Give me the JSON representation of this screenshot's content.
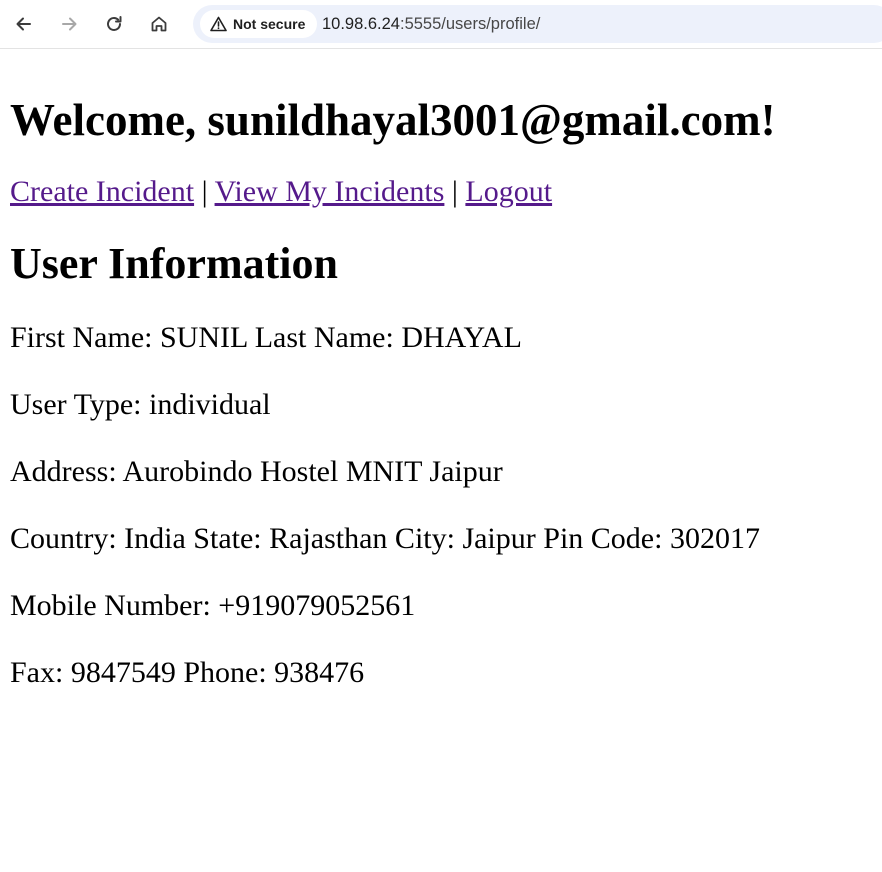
{
  "browser": {
    "security_label": "Not secure",
    "url_host": "10.98.6.24",
    "url_rest": ":5555/users/profile/",
    "icons": {
      "back": "back-arrow-icon",
      "forward": "forward-arrow-icon",
      "reload": "reload-icon",
      "home": "home-icon",
      "warning": "warning-triangle-icon"
    }
  },
  "page": {
    "welcome_heading": "Welcome, sunildhayal3001@gmail.com!",
    "nav_links": {
      "create_incident": "Create Incident",
      "separator": "|",
      "view_incidents": "View My Incidents",
      "logout": "Logout"
    },
    "section_heading": "User Information",
    "info_lines": [
      "First Name: SUNIL Last Name: DHAYAL",
      "User Type: individual",
      "Address: Aurobindo Hostel MNIT Jaipur",
      "Country: India State: Rajasthan City: Jaipur Pin Code: 302017",
      "Mobile Number: +919079052561",
      "Fax: 9847549 Phone: 938476"
    ]
  },
  "colors": {
    "visited_link": "#551a8b",
    "omnibox_bg": "#edf1fb"
  }
}
